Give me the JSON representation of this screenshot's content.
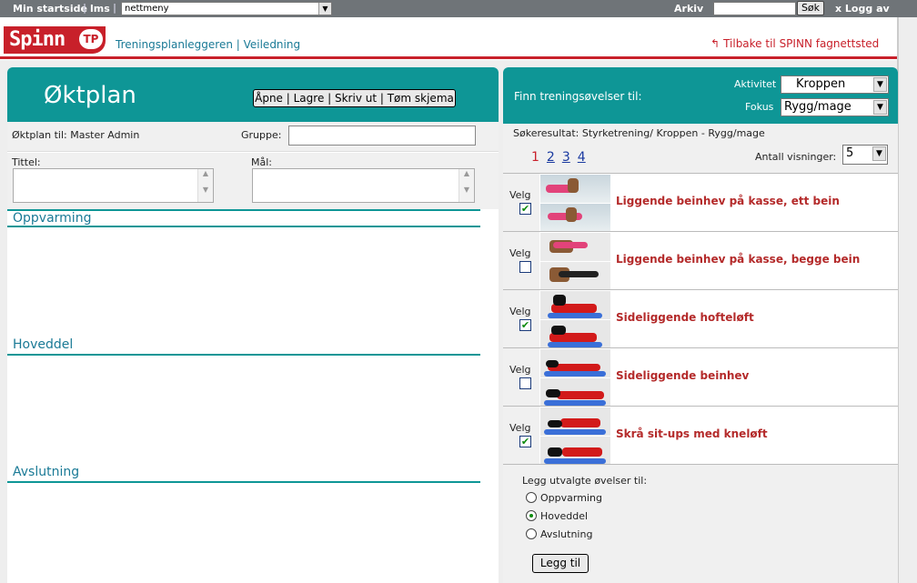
{
  "topbar": {
    "home": "Min startside",
    "lms": "lms",
    "menu_selected": "nettmeny",
    "archive": "Arkiv",
    "search_button": "Søk",
    "logout": "x Logg av"
  },
  "header": {
    "logo_text": "Spinn",
    "logo_badge": "TP",
    "nav": "Treningsplanleggeren | Veiledning",
    "back": "Tilbake til SPINN fagnettsted"
  },
  "plan": {
    "title": "Øktplan",
    "actions": "Åpne | Lagre | Skriv ut | Tøm skjema",
    "plan_for": "Øktplan til: Master Admin",
    "group_label": "Gruppe:",
    "title_label": "Tittel:",
    "goal_label": "Mål:",
    "sections": [
      "Oppvarming",
      "Hoveddel",
      "Avslutning"
    ]
  },
  "finder": {
    "label": "Finn treningsøvelser til:",
    "activity_label": "Aktivitet",
    "activity": "Kroppen",
    "focus_label": "Fokus",
    "focus": "Rygg/mage",
    "result": "Søkeresultat:  Styrketrening/ Kroppen  -  Rygg/mage",
    "pages": [
      "1",
      "2",
      "3",
      "4"
    ],
    "views_label": "Antall visninger:",
    "views": "5"
  },
  "exercises": [
    {
      "velg": "Velg",
      "checked": true,
      "check": "✔",
      "name": "Liggende beinhev på kasse, ett bein"
    },
    {
      "velg": "Velg",
      "checked": false,
      "check": "",
      "name": "Liggende beinhev på kasse, begge bein"
    },
    {
      "velg": "Velg",
      "checked": true,
      "check": "✔",
      "name": "Sideliggende hofteløft"
    },
    {
      "velg": "Velg",
      "checked": false,
      "check": "",
      "name": "Sideliggende beinhev"
    },
    {
      "velg": "Velg",
      "checked": true,
      "check": "✔",
      "name": "Skrå sit-ups med kneløft"
    }
  ],
  "add": {
    "label": "Legg utvalgte øvelser til:",
    "options": [
      "Oppvarming",
      "Hoveddel",
      "Avslutning"
    ],
    "selected": "Hoveddel",
    "button": "Legg til"
  }
}
